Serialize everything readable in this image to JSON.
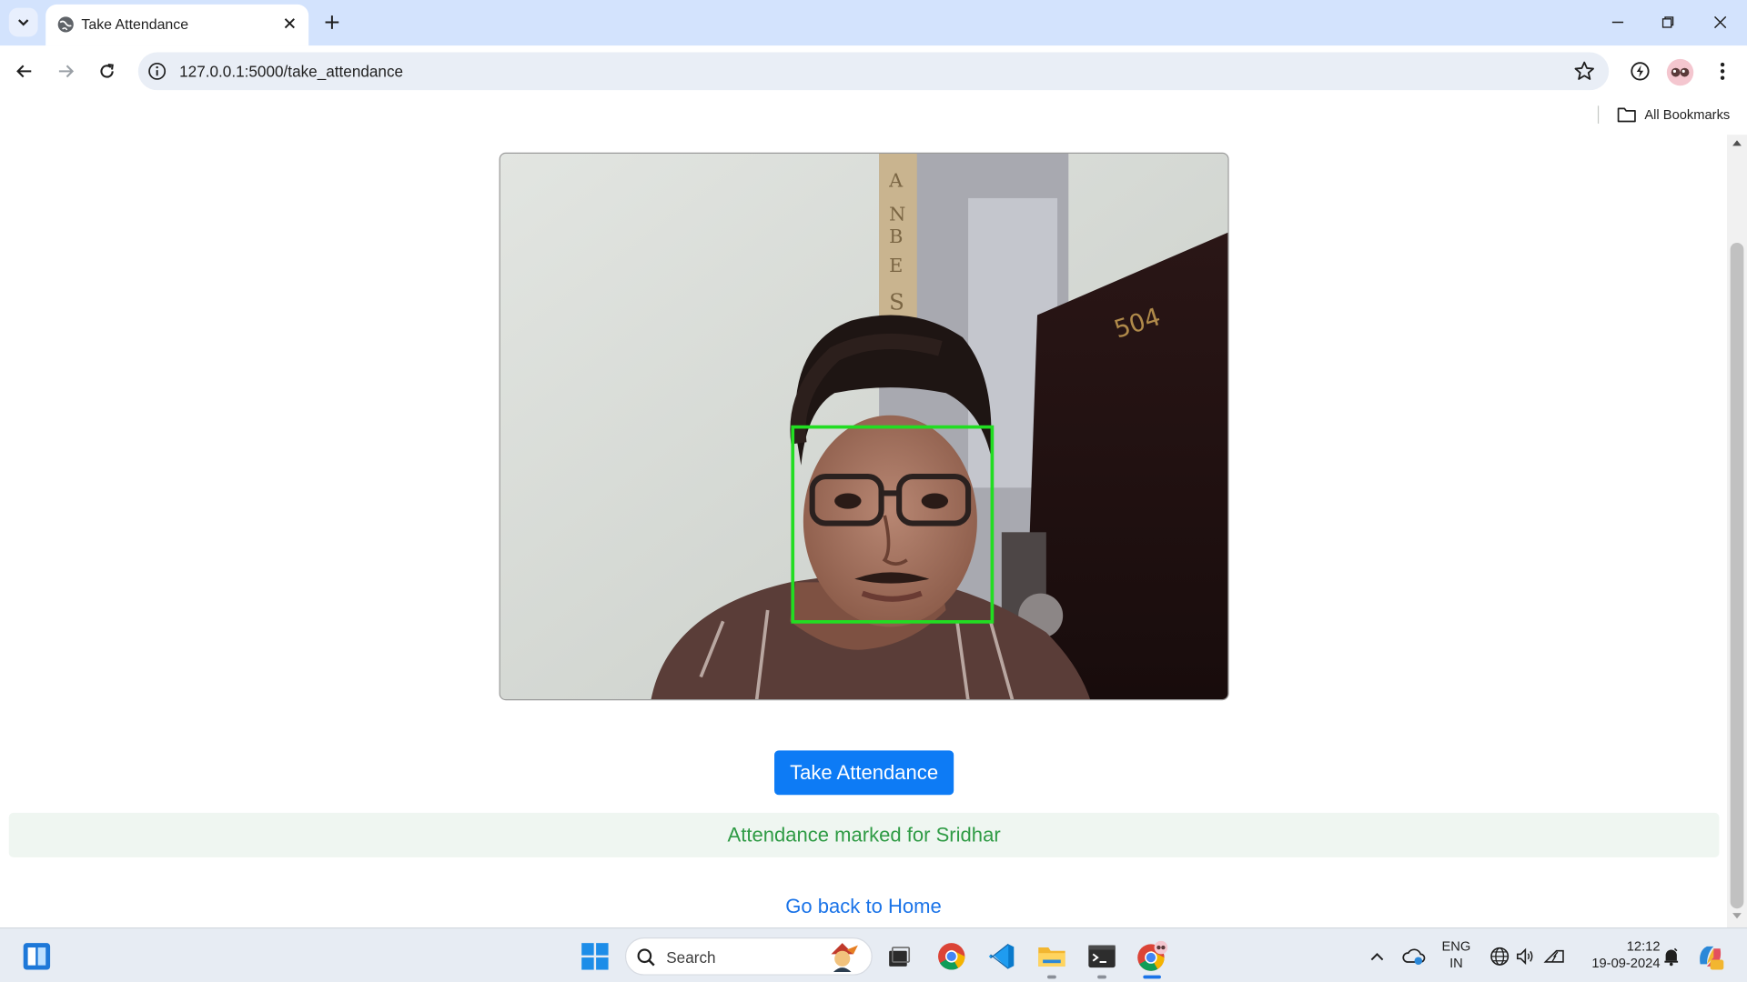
{
  "browser": {
    "tab_title": "Take Attendance",
    "url": "127.0.0.1:5000/take_attendance",
    "bookmarks_label": "All Bookmarks"
  },
  "page": {
    "camera_overlay_text": "504",
    "wall_strip_text": "A N B E S",
    "take_attendance_label": "Take Attendance",
    "alert_message": "Attendance marked for Sridhar",
    "home_link_label": "Go back to Home",
    "colors": {
      "button": "#0d7bf5",
      "alert_bg": "#eff6f1",
      "alert_text": "#2f9b45",
      "link": "#1a73e8",
      "face_box": "#22dd22"
    }
  },
  "taskbar": {
    "search_label": "Search",
    "lang_line1": "ENG",
    "lang_line2": "IN",
    "time": "12:12",
    "date": "19-09-2024"
  },
  "icons": [
    "tab-search-icon",
    "globe-icon",
    "close-icon",
    "plus-icon",
    "minimize-icon",
    "restore-icon",
    "back-icon",
    "forward-icon",
    "reload-icon",
    "info-icon",
    "star-icon",
    "extension-icon",
    "menu-icon",
    "folder-icon",
    "widgets-icon",
    "windows-start-icon",
    "search-icon",
    "task-view-icon",
    "chrome-icon",
    "vscode-icon",
    "file-explorer-icon",
    "terminal-icon",
    "chevron-up-icon",
    "onedrive-icon",
    "network-icon",
    "volume-icon",
    "battery-icon",
    "notification-icon",
    "copilot-icon"
  ]
}
